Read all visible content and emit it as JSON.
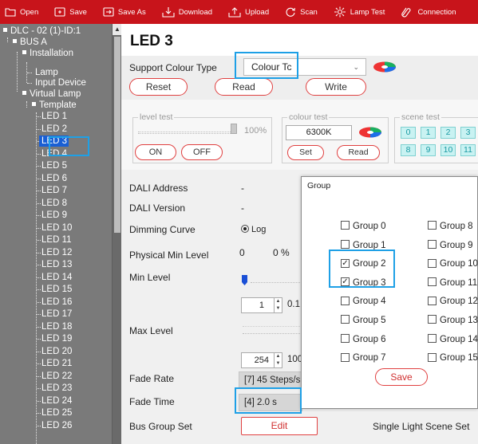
{
  "toolbar": {
    "open": "Open",
    "save": "Save",
    "save_as": "Save As",
    "download": "Download",
    "upload": "Upload",
    "scan": "Scan",
    "lamp_test": "Lamp Test",
    "connection": "Connection"
  },
  "tree": {
    "root": "DLC - 02 (1)-ID:1",
    "bus": "BUS A",
    "installation": "Installation",
    "lamp": "Lamp",
    "input_device": "Input Device",
    "virtual_lamp": "Virtual Lamp",
    "template": "Template",
    "leds": [
      "LED 1",
      "LED 2",
      "LED 3",
      "LED 4",
      "LED 5",
      "LED 6",
      "LED 7",
      "LED 8",
      "LED 9",
      "LED 10",
      "LED 11",
      "LED 12",
      "LED 13",
      "LED 14",
      "LED 15",
      "LED 16",
      "LED 17",
      "LED 18",
      "LED 19",
      "LED 20",
      "LED 21",
      "LED 22",
      "LED 23",
      "LED 24",
      "LED 25",
      "LED 26"
    ],
    "selected": "LED 3"
  },
  "main": {
    "title": "LED 3",
    "support_colour_label": "Support Colour Type",
    "support_colour_value": "Colour Tc",
    "reset": "Reset",
    "read": "Read",
    "write": "Write",
    "level_test": {
      "legend": "level test",
      "value": "100%",
      "level_fraction": 1.0,
      "on": "ON",
      "off": "OFF"
    },
    "colour_test": {
      "legend": "colour test",
      "value": "6300K",
      "set": "Set",
      "read": "Read"
    },
    "scene_test": {
      "legend": "scene test",
      "buttons": [
        "0",
        "1",
        "2",
        "3",
        "8",
        "9",
        "10",
        "11"
      ]
    },
    "dali_address_label": "DALI Address",
    "dali_address_value": "-",
    "dali_version_label": "DALI Version",
    "dali_version_value": "-",
    "dimming_curve_label": "Dimming Curve",
    "dimming_curve_value": "Log",
    "physical_min_label": "Physical Min Level",
    "physical_min_value": "0",
    "physical_min_percent": "0 %",
    "min_level_label": "Min Level",
    "min_level_value": "1",
    "min_level_percent": "0.1",
    "max_level_label": "Max Level",
    "max_level_value": "254",
    "max_level_percent": "100",
    "fade_rate_label": "Fade Rate",
    "fade_rate_value": "[7] 45 Steps/s",
    "fade_time_label": "Fade Time",
    "fade_time_value": "[4] 2.0 s",
    "bus_group_set_label": "Bus Group Set",
    "edit": "Edit",
    "single_light_scene_set": "Single Light Scene Set"
  },
  "dialog": {
    "title": "Group",
    "groups": [
      {
        "label": "Group 0",
        "checked": false
      },
      {
        "label": "Group 1",
        "checked": false
      },
      {
        "label": "Group 2",
        "checked": true
      },
      {
        "label": "Group 3",
        "checked": true
      },
      {
        "label": "Group 4",
        "checked": false
      },
      {
        "label": "Group 5",
        "checked": false
      },
      {
        "label": "Group 6",
        "checked": false
      },
      {
        "label": "Group 7",
        "checked": false
      },
      {
        "label": "Group 8",
        "checked": false
      },
      {
        "label": "Group 9",
        "checked": false
      },
      {
        "label": "Group 10",
        "checked": false
      },
      {
        "label": "Group 11",
        "checked": false
      },
      {
        "label": "Group 12",
        "checked": false
      },
      {
        "label": "Group 13",
        "checked": false
      },
      {
        "label": "Group 14",
        "checked": false
      },
      {
        "label": "Group 15",
        "checked": false
      }
    ],
    "save": "Save"
  },
  "colors": {
    "toolbar_bg": "#c8141b",
    "sidebar_bg": "#7a7a7a",
    "highlight": "#1ea0e6",
    "button_border": "#e04040",
    "scene_bg": "#c9f2f2",
    "slider_blue": "#1a4fd6"
  }
}
